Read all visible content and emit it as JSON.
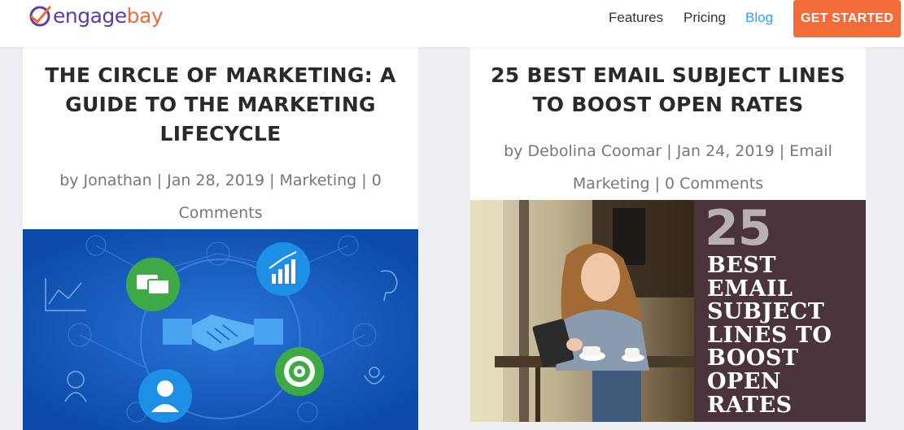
{
  "header": {
    "logo": {
      "part1": "engage",
      "part2": "bay"
    },
    "nav": [
      "Features",
      "Pricing",
      "Blog"
    ],
    "cta": "GET STARTED"
  },
  "posts": [
    {
      "title_lines": [
        "THE CIRCLE OF MARKETING: A",
        "GUIDE TO THE MARKETING",
        "LIFECYCLE"
      ],
      "meta_lines": [
        "by Jonathan | Jan 28, 2019 | Marketing | 0",
        "Comments"
      ],
      "author": "Jonathan",
      "date": "Jan 28, 2019",
      "category": "Marketing",
      "comments": "0 Comments"
    },
    {
      "title_lines": [
        "25 BEST EMAIL SUBJECT LINES",
        "TO BOOST OPEN RATES"
      ],
      "meta_lines": [
        "by Debolina Coomar | Jan 24, 2019 | Email",
        "Marketing | 0 Comments"
      ],
      "author": "Debolina Coomar",
      "date": "Jan 24, 2019",
      "category": "Email Marketing",
      "comments": "0 Comments",
      "image_text": {
        "number": "25",
        "lines": [
          "BEST",
          "EMAIL",
          "SUBJECT",
          "LINES TO",
          "BOOST",
          "OPEN",
          "RATES"
        ]
      }
    }
  ],
  "colors": {
    "brand_purple": "#5b3ea0",
    "brand_orange": "#ef6a3a",
    "cta": "#f26b38",
    "active_nav": "#2ea3f2",
    "image_blue": "#0d52b7"
  }
}
